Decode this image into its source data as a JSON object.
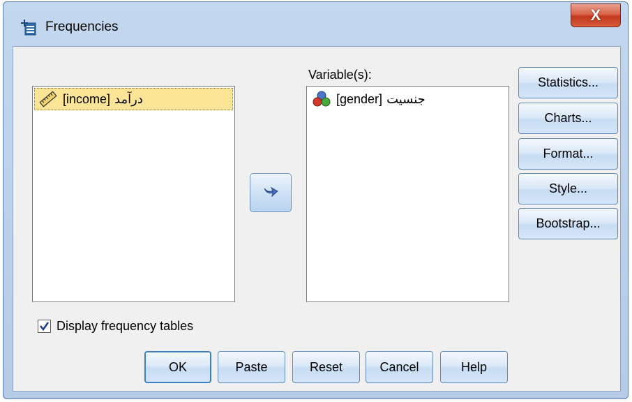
{
  "window": {
    "title": "Frequencies",
    "close_label": "X"
  },
  "source": {
    "items": [
      {
        "label": "[income]",
        "arabic": "درآمد",
        "icon": "ruler-scale-icon",
        "selected": true
      }
    ]
  },
  "target": {
    "label": "Variable(s):",
    "items": [
      {
        "label": "[gender]",
        "arabic": "جنسیت",
        "icon": "nominal-balls-icon"
      }
    ]
  },
  "move_button": {
    "icon": "arrow-right-icon"
  },
  "side_buttons": {
    "statistics": "Statistics...",
    "charts": "Charts...",
    "format": "Format...",
    "style": "Style...",
    "bootstrap": "Bootstrap..."
  },
  "checkbox": {
    "label": "Display frequency tables",
    "checked": true
  },
  "bottom_buttons": {
    "ok": "OK",
    "paste": "Paste",
    "reset": "Reset",
    "cancel": "Cancel",
    "help": "Help"
  },
  "colors": {
    "selection": "#fce596",
    "frame": "#b5cbe6",
    "close": "#c2381c",
    "accent": "#3c7fc4"
  }
}
